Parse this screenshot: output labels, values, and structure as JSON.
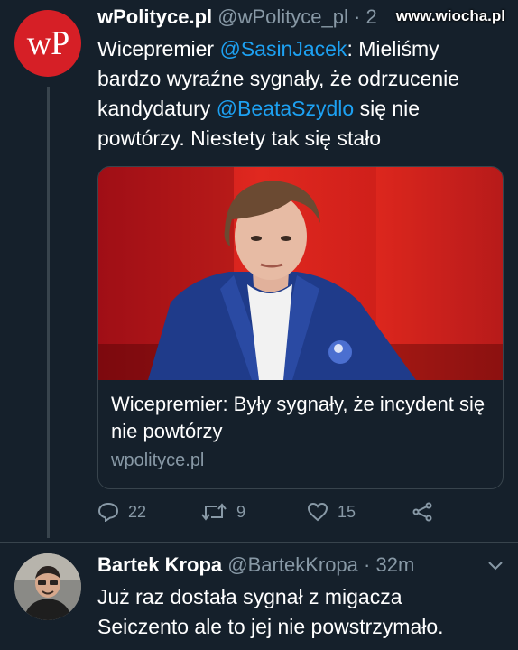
{
  "watermark": "www.wiocha.pl",
  "tweet": {
    "avatar_text": "wP",
    "author_name": "wPolityce.pl",
    "author_handle": "@wPolityce_pl",
    "separator": "·",
    "time": "2",
    "text_parts": [
      "Wicepremier ",
      "@SasinJacek",
      ": Mieliśmy bardzo wyraźne sygnały, że odrzucenie kandydatury ",
      "@BeataSzydlo",
      " się nie powtórzy. Niestety tak się stało"
    ],
    "card": {
      "title": "Wicepremier: Były sygnały, że incydent się nie powtórzy",
      "domain": "wpolityce.pl"
    },
    "actions": {
      "replies": "22",
      "retweets": "9",
      "likes": "15"
    }
  },
  "reply": {
    "author_name": "Bartek Kropa",
    "author_handle": "@BartekKropa",
    "separator": "·",
    "time": "32m",
    "text": "Już raz dostała sygnał z migacza Seiczento ale to jej nie powstrzymało."
  },
  "colors": {
    "background": "#15202b",
    "accent": "#1da1f2",
    "muted": "#8899a6",
    "border": "#38444d",
    "brand_red": "#d61f26"
  }
}
